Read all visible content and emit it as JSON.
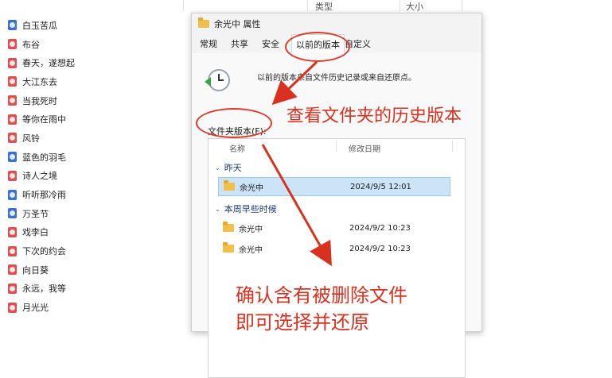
{
  "explorer": {
    "columns": {
      "type": "类型",
      "size": "大小"
    },
    "files": [
      {
        "name": "白玉苦瓜",
        "icon": "blue"
      },
      {
        "name": "布谷",
        "icon": "red"
      },
      {
        "name": "春天，遂想起",
        "icon": "red"
      },
      {
        "name": "大江东去",
        "icon": "red"
      },
      {
        "name": "当我死时",
        "icon": "red"
      },
      {
        "name": "等你在雨中",
        "icon": "red"
      },
      {
        "name": "风铃",
        "icon": "red"
      },
      {
        "name": "蓝色的羽毛",
        "icon": "blue"
      },
      {
        "name": "诗人之境",
        "icon": "red"
      },
      {
        "name": "听听那冷雨",
        "icon": "blue"
      },
      {
        "name": "万圣节",
        "icon": "blue"
      },
      {
        "name": "戏李白",
        "icon": "red"
      },
      {
        "name": "下次的约会",
        "icon": "red"
      },
      {
        "name": "向日葵",
        "icon": "red"
      },
      {
        "name": "永远，我等",
        "icon": "red"
      },
      {
        "name": "月光光",
        "icon": "red"
      }
    ]
  },
  "dialog": {
    "title": "余光中 属性",
    "tabs": [
      "常规",
      "共享",
      "安全",
      "以前的版本",
      "自定义"
    ],
    "description": "以前的版本来自文件历史记录或来自还原点。",
    "versions_label": "文件夹版本(F):",
    "columns": {
      "name": "名称",
      "modified": "修改日期"
    },
    "groups": [
      {
        "label": "昨天",
        "items": [
          {
            "name": "余光中",
            "date": "2024/9/5 12:01",
            "selected": true
          }
        ]
      },
      {
        "label": "本周早些时候",
        "items": [
          {
            "name": "余光中",
            "date": "2024/9/2 10:23",
            "selected": false
          },
          {
            "name": "余光中",
            "date": "2024/9/2 10:23",
            "selected": false
          }
        ]
      }
    ]
  },
  "annotations": {
    "view_history": "查看文件夹的历史版本",
    "confirm_line1": "确认含有被删除文件",
    "confirm_line2": "即可选择并还原",
    "color": "#d9311f"
  },
  "colors": {
    "selection": "#cce4f7",
    "folder": "#f2c04a",
    "accent_red": "#d93a2a"
  }
}
